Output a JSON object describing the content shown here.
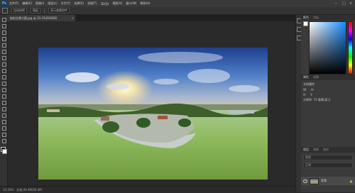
{
  "app": {
    "logo": "Ps"
  },
  "menu": {
    "items": [
      "文件(F)",
      "编辑(E)",
      "图像(I)",
      "图层(L)",
      "文字(Y)",
      "选择(S)",
      "滤镜(T)",
      "3D(D)",
      "视图(V)",
      "窗口(W)",
      "帮助(H)"
    ]
  },
  "window_controls": [
    "–",
    "□",
    "×"
  ],
  "options": {
    "items": [
      "自动选择",
      "图层",
      "显示变换控件"
    ]
  },
  "document": {
    "tab_title": "航拍全景大图.jpg @ 33.3%(RGB/8)",
    "tab_close": "×"
  },
  "status": {
    "zoom": "33.33%",
    "doc_info": "文档:26.4M/26.4M"
  },
  "panels": {
    "color_tabs": [
      "颜色",
      "色板"
    ],
    "properties_tabs": [
      "属性",
      "调整"
    ],
    "properties_title": "文档属性",
    "properties_rows": [
      [
        "W:",
        "H:"
      ],
      [
        "X:",
        "Y:"
      ]
    ],
    "properties_resolution": "分辨率: 72 像素/英寸",
    "layers_tabs": [
      "图层",
      "通道",
      "路径"
    ],
    "layers_filter": "类型",
    "layers_mode": "正常",
    "layer_name": "背景",
    "layer_lock": "🔒"
  },
  "colors": {
    "accent": "#1a8dff",
    "panel_bg": "#3a3a3a",
    "canvas_bg": "#2a2a2a"
  }
}
